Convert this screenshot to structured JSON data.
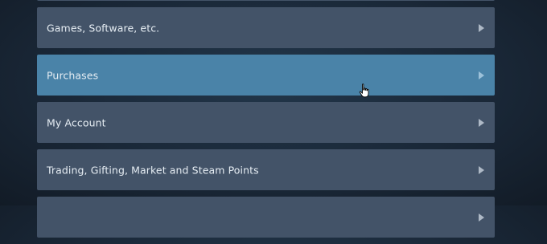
{
  "menu": {
    "items": [
      {
        "label": ""
      },
      {
        "label": "Games, Software, etc."
      },
      {
        "label": "Purchases"
      },
      {
        "label": "My Account"
      },
      {
        "label": "Trading, Gifting, Market and Steam Points"
      },
      {
        "label": ""
      }
    ],
    "highlighted_item": "Purchases"
  },
  "colors": {
    "background": "#1b2838",
    "item": "#435368",
    "item_highlighted": "#4a83a8",
    "text": "#e6edf3"
  },
  "cursor": {
    "icon": "hand-pointer-icon"
  }
}
